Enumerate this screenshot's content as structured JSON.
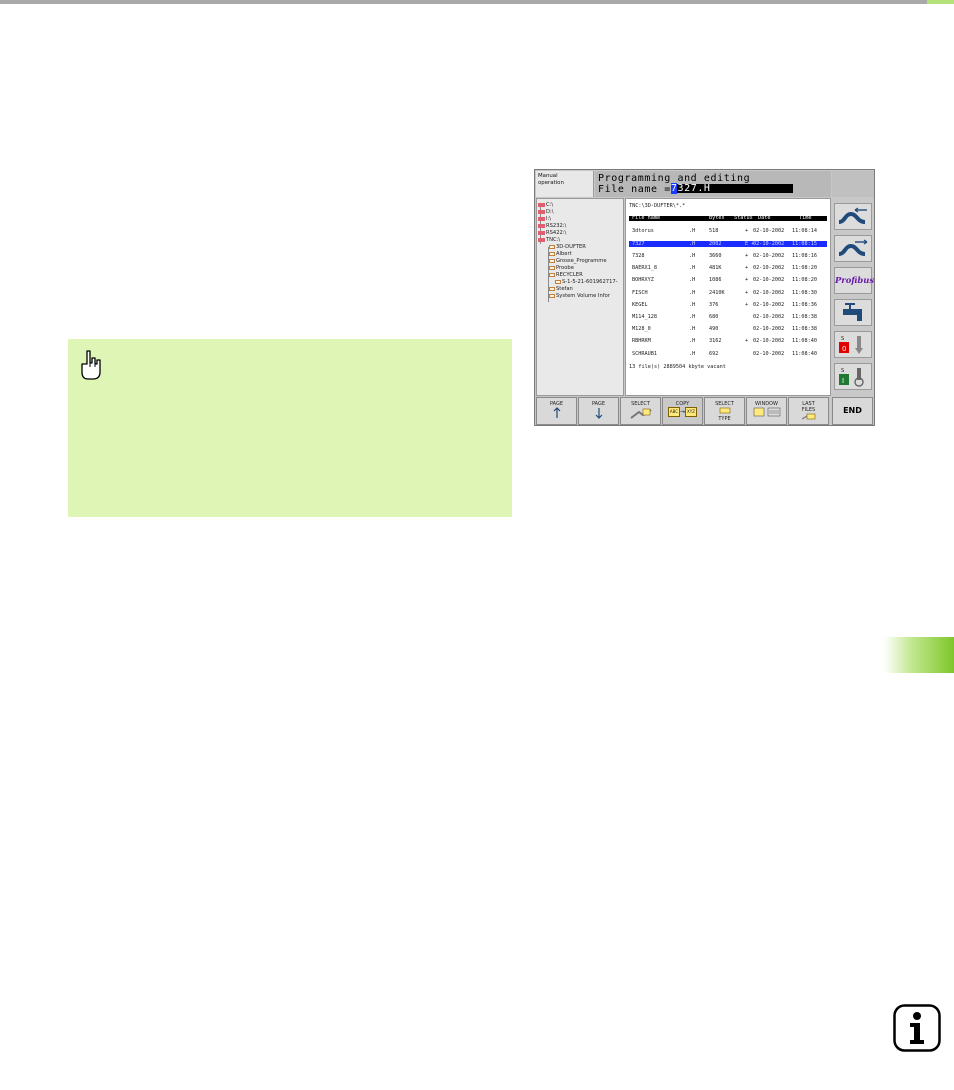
{
  "tnc": {
    "mode": [
      "Manual",
      "operation"
    ],
    "heading": "Programming and editing",
    "file_name_label": "File name =",
    "file_name_cursor": "7",
    "file_name_rest": "327.H",
    "tree": [
      "C:\\",
      "D:\\",
      "I:\\",
      "RS232:\\",
      "RS422:\\",
      "TNC:\\",
      "3D-DUFTER",
      "Albert",
      "Grosse_Programme",
      "Proobe",
      "RECYCLER",
      "S-1-5-21-601962717-",
      "Stefan",
      "System Volume Infor"
    ],
    "path": "TNC:\\3D-DUFTER\\*.*",
    "columns": [
      "File name",
      "Bytes",
      "Status",
      "Date",
      "Time"
    ],
    "files": [
      {
        "name": "3dtorus",
        "ext": ".H",
        "bytes": "518",
        "status": "+",
        "date": "02-10-2002",
        "time": "11:08:14"
      },
      {
        "name": "7327",
        "ext": ".H",
        "bytes": "2002",
        "status": "E +",
        "date": "02-10-2002",
        "time": "11:08:15"
      },
      {
        "name": "7328",
        "ext": ".H",
        "bytes": "3660",
        "status": "+",
        "date": "02-10-2002",
        "time": "11:08:16"
      },
      {
        "name": "BAERX1_8",
        "ext": ".H",
        "bytes": "481K",
        "status": "+",
        "date": "02-10-2002",
        "time": "11:08:20"
      },
      {
        "name": "BOHRXYZ",
        "ext": ".H",
        "bytes": "1086",
        "status": "+",
        "date": "02-10-2002",
        "time": "11:08:20"
      },
      {
        "name": "FISCH",
        "ext": ".H",
        "bytes": "2410K",
        "status": "+",
        "date": "02-10-2002",
        "time": "11:08:30"
      },
      {
        "name": "KEGEL",
        "ext": ".H",
        "bytes": "376",
        "status": "+",
        "date": "02-10-2002",
        "time": "11:08:36"
      },
      {
        "name": "M114_128",
        "ext": ".H",
        "bytes": "680",
        "status": "",
        "date": "02-10-2002",
        "time": "11:08:38"
      },
      {
        "name": "M128_0",
        "ext": ".H",
        "bytes": "490",
        "status": "",
        "date": "02-10-2002",
        "time": "11:08:38"
      },
      {
        "name": "RBHRKM",
        "ext": ".H",
        "bytes": "3162",
        "status": "+",
        "date": "02-10-2002",
        "time": "11:08:40"
      },
      {
        "name": "SCHRAUB1",
        "ext": ".H",
        "bytes": "692",
        "status": "",
        "date": "02-10-2002",
        "time": "11:08:40"
      }
    ],
    "summary": "13 file(s) 2889504 kbyte vacant",
    "side_buttons": [
      "Profibus",
      "0",
      "I"
    ],
    "softkeys": [
      {
        "line1": "PAGE",
        "line2": ""
      },
      {
        "line1": "PAGE",
        "line2": ""
      },
      {
        "line1": "SELECT",
        "line2": ""
      },
      {
        "line1": "COPY",
        "line2": "ABC",
        "line3": "XYZ"
      },
      {
        "line1": "SELECT",
        "line2": "TYPE"
      },
      {
        "line1": "WINDOW",
        "line2": ""
      },
      {
        "line1": "LAST",
        "line2": "FILES"
      },
      {
        "line1": "END",
        "line2": ""
      }
    ]
  },
  "icons": {
    "note": "hand-pointing-icon",
    "info": "info-icon"
  },
  "colors": {
    "note_background": "#dff5b6",
    "chapter_tab": "#7ec72a",
    "selection": "#1a2cff",
    "profibus_text": "#6a1ba8"
  }
}
